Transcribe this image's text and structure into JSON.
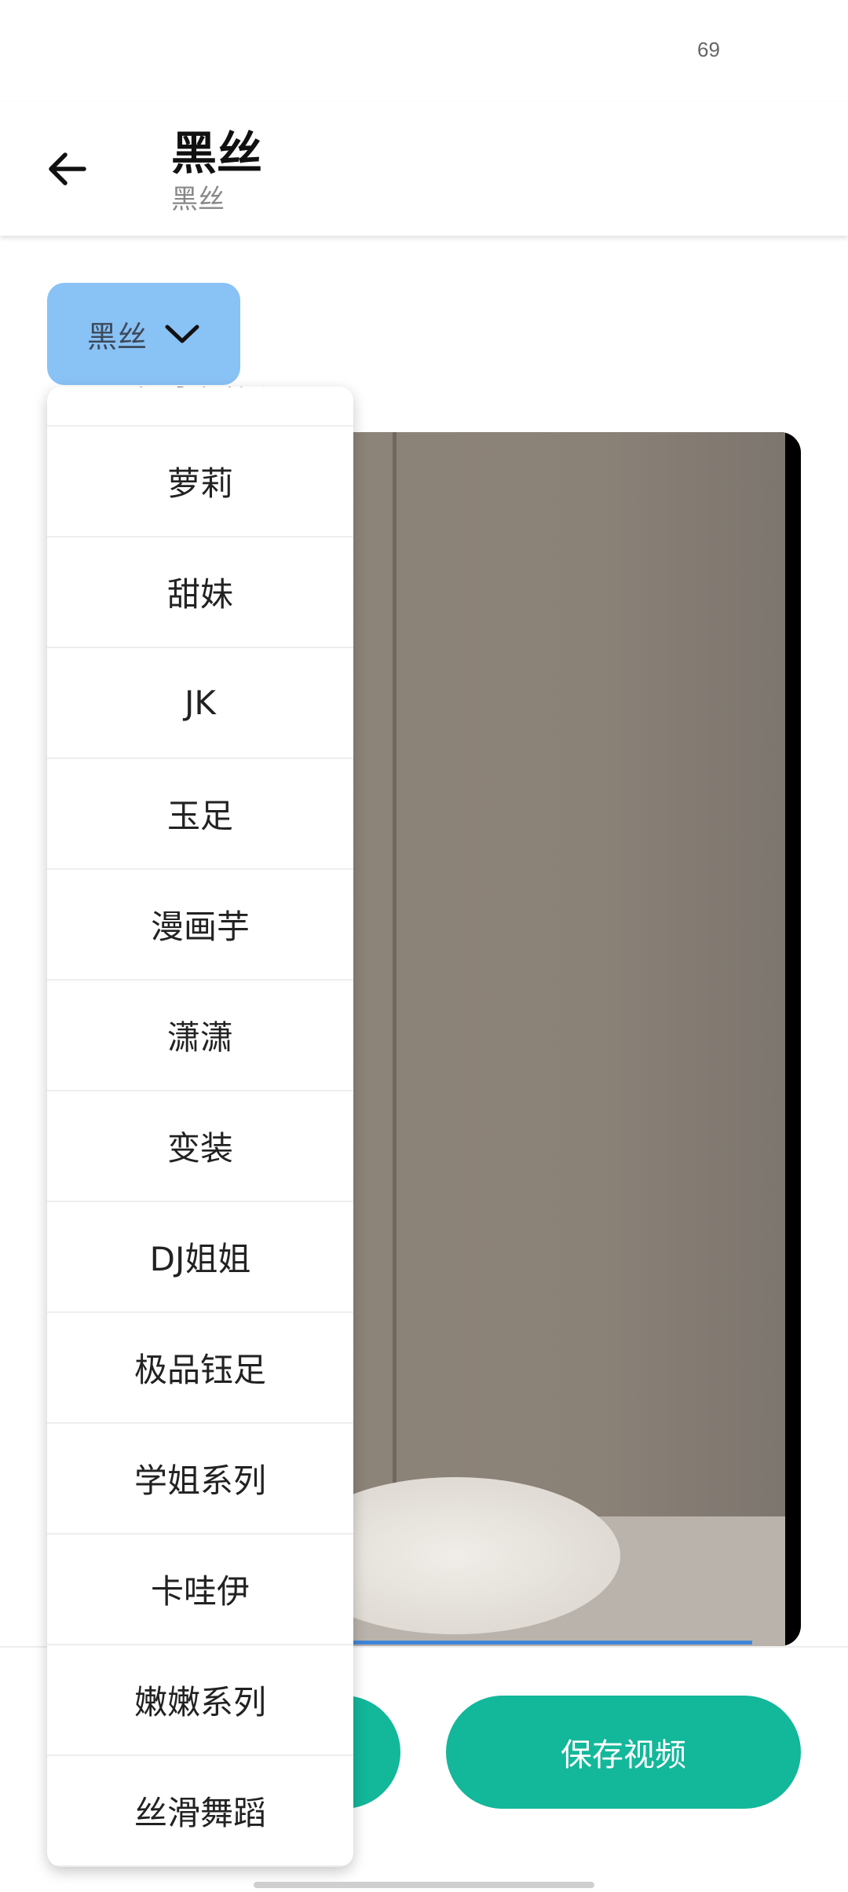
{
  "status_bar": {
    "battery": "69"
  },
  "header": {
    "title": "黑丝",
    "subtitle": "黑丝",
    "back_icon": "arrow-left-icon"
  },
  "category_select": {
    "selected": "黑丝",
    "icon": "chevron-down-icon"
  },
  "dropdown": {
    "items": [
      "伪享变装",
      "萝莉",
      "甜妹",
      "JK",
      "玉足",
      "漫画芋",
      "潇潇",
      "变装",
      "DJ姐姐",
      "极品钰足",
      "学姐系列",
      "卡哇伊",
      "嫩嫩系列",
      "丝滑舞蹈"
    ]
  },
  "actions": {
    "save_video_label": "保存视频"
  },
  "colors": {
    "accent": "#13b79a",
    "select_bg": "#89c2f5",
    "progress": "#3f86d8"
  }
}
